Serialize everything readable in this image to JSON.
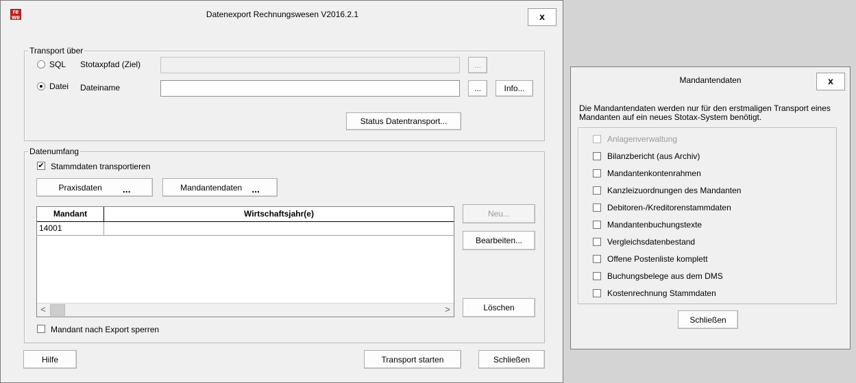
{
  "main_window": {
    "title": "Datenexport Rechnungswesen V2016.2.1",
    "logo_text": "re\nwe",
    "close_label": "x",
    "transport_group": {
      "label": "Transport über",
      "sql_option": "SQL",
      "sql_path_label": "Stotaxpfad (Ziel)",
      "sql_path_value": "",
      "file_option": "Datei",
      "file_name_label": "Dateiname",
      "file_name_value": "",
      "browse_label": "...",
      "info_label": "Info...",
      "status_label": "Status Datentransport..."
    },
    "scope_group": {
      "label": "Datenumfang",
      "master_data_label": "Stammdaten transportieren",
      "practice_data_label": "Praxisdaten",
      "client_data_label": "Mandantendaten",
      "ellipsis": "...",
      "table": {
        "columns": [
          "Mandant",
          "Wirtschaftsjahr(e)"
        ],
        "rows": [
          [
            "14001",
            ""
          ]
        ]
      },
      "new_label": "Neu...",
      "edit_label": "Bearbeiten...",
      "delete_label": "Löschen",
      "lock_label": "Mandant nach Export sperren",
      "scroll_left": "<",
      "scroll_right": ">"
    },
    "help_label": "Hilfe",
    "start_label": "Transport starten",
    "close_button_label": "Schließen"
  },
  "mandant_window": {
    "title": "Mandantendaten",
    "close_label": "x",
    "description": "Die Mandantendaten werden nur für den erstmaligen Transport eines Mandanten auf ein neues Stotax-System benötigt.",
    "items": [
      {
        "label": "Anlagenverwaltung",
        "disabled": true
      },
      {
        "label": "Bilanzbericht (aus Archiv)",
        "disabled": false
      },
      {
        "label": "Mandantenkontenrahmen",
        "disabled": false
      },
      {
        "label": "Kanzleizuordnungen des Mandanten",
        "disabled": false
      },
      {
        "label": "Debitoren-/Kreditorenstammdaten",
        "disabled": false
      },
      {
        "label": "Mandantenbuchungstexte",
        "disabled": false
      },
      {
        "label": "Vergleichsdatenbestand",
        "disabled": false
      },
      {
        "label": "Offene Postenliste komplett",
        "disabled": false
      },
      {
        "label": "Buchungsbelege aus dem DMS",
        "disabled": false
      },
      {
        "label": "Kostenrechnung Stammdaten",
        "disabled": false
      }
    ],
    "close_button_label": "Schließen"
  },
  "colors": {
    "background": "#d4d4d4",
    "window": "#f0f0f0",
    "logo_red": "#b3261e"
  }
}
